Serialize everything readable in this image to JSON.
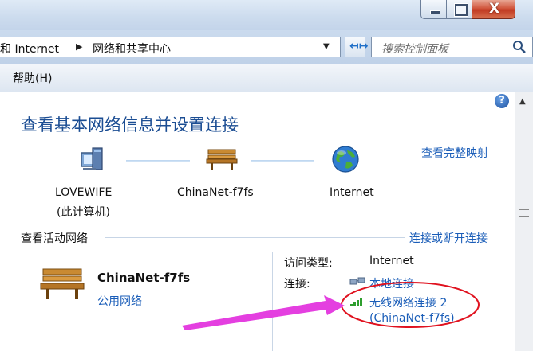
{
  "window": {
    "minimize_label": "",
    "maximize_label": "",
    "close_label": "X"
  },
  "address": {
    "crumb_1": "和 Internet",
    "crumb_2": "网络和共享中心",
    "search_placeholder": "搜索控制面板"
  },
  "menu": {
    "help": "帮助(H)"
  },
  "main": {
    "title": "查看基本网络信息并设置连接",
    "full_map_link": "查看完整映射",
    "map": {
      "computer_name": "LOVEWIFE",
      "computer_sub": "(此计算机)",
      "network_name": "ChinaNet-f7fs",
      "internet_name": "Internet"
    },
    "active_networks_heading": "查看活动网络",
    "connect_disconnect_link": "连接或断开连接",
    "active": {
      "network_name": "ChinaNet-f7fs",
      "network_type": "公用网络",
      "access_type_label": "访问类型:",
      "access_type_value": "Internet",
      "connections_label": "连接:",
      "connection_1": "本地连接",
      "connection_2_line1": "无线网络连接 2",
      "connection_2_line2": "(ChinaNet-f7fs)"
    }
  },
  "colors": {
    "link": "#1a5db8",
    "title": "#1b4d93",
    "annotation_ellipse": "#e0121f",
    "annotation_arrow": "#e43fe0"
  }
}
